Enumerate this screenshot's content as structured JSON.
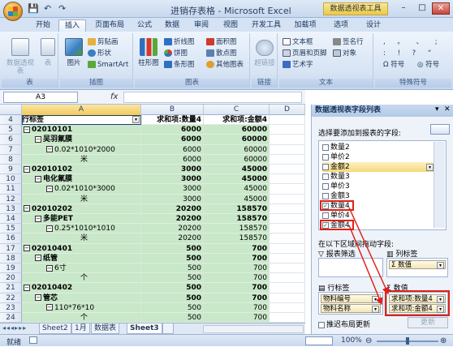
{
  "window": {
    "title": "进销存表格 - Microsoft Excel",
    "contextual_tab_group": "数据透视表工具",
    "controls": {
      "minimize": "–",
      "maximize": "□",
      "close": "✕"
    }
  },
  "quick_access": {
    "save": "💾",
    "undo": "↶",
    "redo": "↷"
  },
  "tabs": [
    "开始",
    "插入",
    "页面布局",
    "公式",
    "数据",
    "审阅",
    "视图",
    "开发工具",
    "加载项",
    "选项",
    "设计"
  ],
  "active_tab": "插入",
  "ribbon": {
    "groups": [
      {
        "label": "表",
        "buttons": [
          "数据透视表",
          "表"
        ]
      },
      {
        "label": "插图",
        "buttons": [
          "图片",
          "剪贴画",
          "形状",
          "SmartArt"
        ]
      },
      {
        "label": "图表",
        "buttons": [
          "柱形图",
          "折线图",
          "饼图",
          "条形图",
          "面积图",
          "散点图",
          "其他图表"
        ]
      },
      {
        "label": "链接",
        "buttons": [
          "超链接"
        ]
      },
      {
        "label": "文本",
        "buttons": [
          "文本框",
          "页眉和页脚",
          "艺术字",
          "签名行",
          "对象"
        ]
      },
      {
        "label": "特殊符号",
        "buttons": [
          "符号",
          "符号"
        ]
      }
    ]
  },
  "formula_bar": {
    "name_box": "A3",
    "fx": "fx",
    "formula": ""
  },
  "columns": [
    "A",
    "B",
    "C",
    "D"
  ],
  "rows": [
    {
      "n": "4",
      "a": "行标签",
      "b": "求和项:数量4",
      "c": "求和项:金额4",
      "type": "header"
    },
    {
      "n": "5",
      "a": "02010101",
      "b": "6000",
      "c": "60000",
      "level": 0,
      "bold": true,
      "toggle": "⊟"
    },
    {
      "n": "6",
      "a": "吴羽氟膜",
      "b": "6000",
      "c": "60000",
      "level": 1,
      "bold": true,
      "toggle": "⊟"
    },
    {
      "n": "7",
      "a": "0.02*1010*2000",
      "b": "6000",
      "c": "60000",
      "level": 2,
      "bold": false,
      "toggle": "⊟"
    },
    {
      "n": "8",
      "a": "米",
      "b": "6000",
      "c": "60000",
      "level": 3,
      "bold": false,
      "toggle": ""
    },
    {
      "n": "9",
      "a": "02010102",
      "b": "3000",
      "c": "45000",
      "level": 0,
      "bold": true,
      "toggle": "⊟"
    },
    {
      "n": "10",
      "a": "电化氟膜",
      "b": "3000",
      "c": "45000",
      "level": 1,
      "bold": true,
      "toggle": "⊟"
    },
    {
      "n": "11",
      "a": "0.02*1010*3000",
      "b": "3000",
      "c": "45000",
      "level": 2,
      "bold": false,
      "toggle": "⊟"
    },
    {
      "n": "12",
      "a": "米",
      "b": "3000",
      "c": "45000",
      "level": 3,
      "bold": false,
      "toggle": ""
    },
    {
      "n": "13",
      "a": "02010202",
      "b": "20200",
      "c": "158570",
      "level": 0,
      "bold": true,
      "toggle": "⊟"
    },
    {
      "n": "14",
      "a": "多能PET",
      "b": "20200",
      "c": "158570",
      "level": 1,
      "bold": true,
      "toggle": "⊟"
    },
    {
      "n": "15",
      "a": "0.25*1010*1010",
      "b": "20200",
      "c": "158570",
      "level": 2,
      "bold": false,
      "toggle": "⊟"
    },
    {
      "n": "16",
      "a": "米",
      "b": "20200",
      "c": "158570",
      "level": 3,
      "bold": false,
      "toggle": ""
    },
    {
      "n": "17",
      "a": "02010401",
      "b": "500",
      "c": "700",
      "level": 0,
      "bold": true,
      "toggle": "⊟"
    },
    {
      "n": "18",
      "a": "纸管",
      "b": "500",
      "c": "700",
      "level": 1,
      "bold": true,
      "toggle": "⊟"
    },
    {
      "n": "19",
      "a": "6寸",
      "b": "500",
      "c": "700",
      "level": 2,
      "bold": false,
      "toggle": "⊟"
    },
    {
      "n": "20",
      "a": "个",
      "b": "500",
      "c": "700",
      "level": 3,
      "bold": false,
      "toggle": ""
    },
    {
      "n": "21",
      "a": "02010402",
      "b": "500",
      "c": "700",
      "level": 0,
      "bold": true,
      "toggle": "⊟"
    },
    {
      "n": "22",
      "a": "管芯",
      "b": "500",
      "c": "700",
      "level": 1,
      "bold": true,
      "toggle": "⊟"
    },
    {
      "n": "23",
      "a": "110*76*10",
      "b": "500",
      "c": "700",
      "level": 2,
      "bold": false,
      "toggle": "⊟"
    },
    {
      "n": "24",
      "a": "个",
      "b": "500",
      "c": "700",
      "level": 3,
      "bold": false,
      "toggle": ""
    }
  ],
  "sheet_tabs": [
    "Sheet2",
    "1月",
    "数据表",
    "Sheet3"
  ],
  "active_sheet": "Sheet3",
  "status": {
    "ready": "就绪",
    "zoom": "100%"
  },
  "field_list": {
    "title": "数据透视表字段列表",
    "prompt": "选择要添加到报表的字段:",
    "fields": [
      {
        "name": "数量2",
        "checked": false
      },
      {
        "name": "单价2",
        "checked": false
      },
      {
        "name": "金额2",
        "checked": false,
        "highlight": true
      },
      {
        "name": "数量3",
        "checked": false
      },
      {
        "name": "单价3",
        "checked": false
      },
      {
        "name": "金额3",
        "checked": false
      },
      {
        "name": "数量4",
        "checked": true
      },
      {
        "name": "单价4",
        "checked": false
      },
      {
        "name": "金额4",
        "checked": true
      }
    ],
    "areas_prompt": "在以下区域间拖动字段:",
    "report_filter": "报表筛选",
    "column_labels": "列标签",
    "column_chip": "Σ 数值",
    "row_labels": "行标签",
    "values": "数值",
    "row_chips": [
      "物料编号",
      "物料名称"
    ],
    "value_chips": [
      "求和项:数量4",
      "求和项:金额4"
    ],
    "defer_update": "推迟布局更新",
    "update_button": "更新"
  }
}
